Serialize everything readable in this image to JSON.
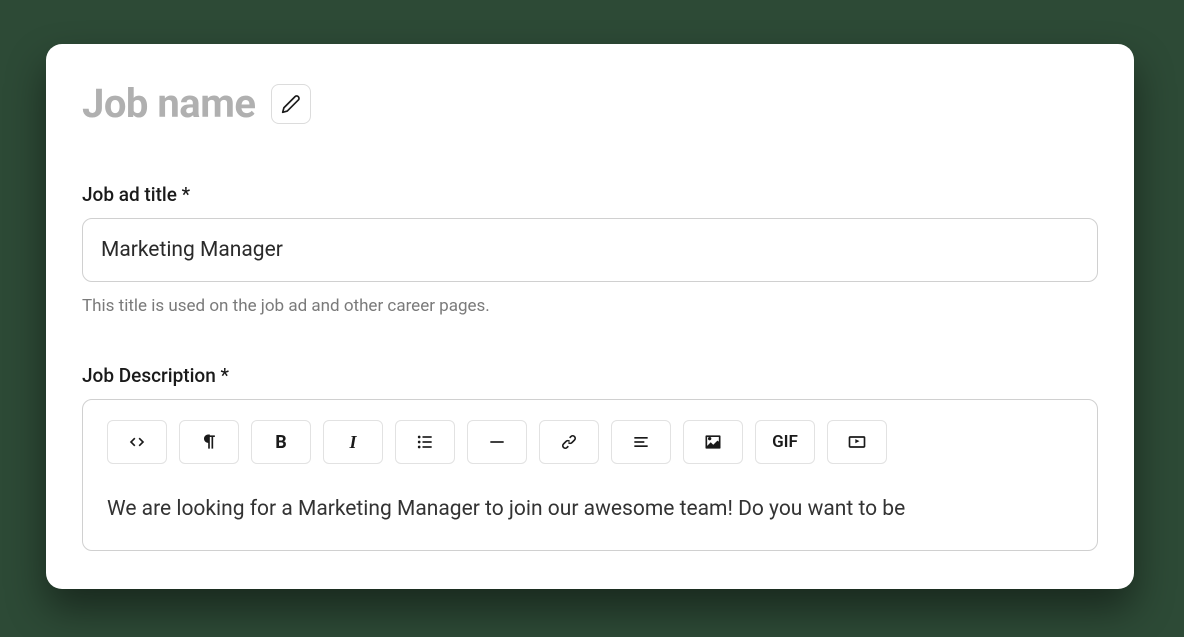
{
  "header": {
    "title_placeholder": "Job name"
  },
  "fields": {
    "ad_title": {
      "label": "Job ad title *",
      "value": "Marketing Manager",
      "helper": "This title is used on the job ad and other career pages."
    },
    "description": {
      "label": "Job Description *",
      "content": "We are looking for a Marketing Manager to join our awesome team! Do you want to be"
    }
  },
  "toolbar": {
    "bold": "B",
    "italic": "I",
    "gif": "GIF"
  }
}
